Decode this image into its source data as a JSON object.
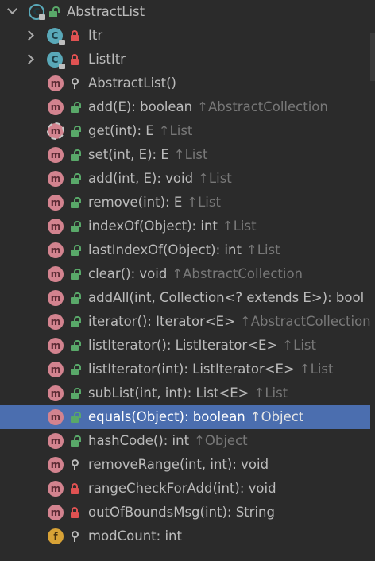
{
  "root": {
    "label": "AbstractList",
    "kind_letter": "C",
    "visibility": "public"
  },
  "inner_classes": [
    {
      "label": "Itr",
      "kind_letter": "C",
      "visibility": "private"
    },
    {
      "label": "ListItr",
      "kind_letter": "C",
      "visibility": "private"
    }
  ],
  "members": [
    {
      "kind": "method",
      "letter": "m",
      "visibility": "protected",
      "label": "AbstractList()",
      "inherited_from": ""
    },
    {
      "kind": "method",
      "letter": "m",
      "visibility": "public",
      "label": "add(E): boolean",
      "inherited_from": "AbstractCollection"
    },
    {
      "kind": "method",
      "letter": "m",
      "visibility": "public",
      "label": "get(int): E",
      "inherited_from": "List",
      "abstract": true
    },
    {
      "kind": "method",
      "letter": "m",
      "visibility": "public",
      "label": "set(int, E): E",
      "inherited_from": "List"
    },
    {
      "kind": "method",
      "letter": "m",
      "visibility": "public",
      "label": "add(int, E): void",
      "inherited_from": "List"
    },
    {
      "kind": "method",
      "letter": "m",
      "visibility": "public",
      "label": "remove(int): E",
      "inherited_from": "List"
    },
    {
      "kind": "method",
      "letter": "m",
      "visibility": "public",
      "label": "indexOf(Object): int",
      "inherited_from": "List"
    },
    {
      "kind": "method",
      "letter": "m",
      "visibility": "public",
      "label": "lastIndexOf(Object): int",
      "inherited_from": "List"
    },
    {
      "kind": "method",
      "letter": "m",
      "visibility": "public",
      "label": "clear(): void",
      "inherited_from": "AbstractCollection"
    },
    {
      "kind": "method",
      "letter": "m",
      "visibility": "public",
      "label": "addAll(int, Collection<? extends E>): bool",
      "inherited_from": ""
    },
    {
      "kind": "method",
      "letter": "m",
      "visibility": "public",
      "label": "iterator(): Iterator<E>",
      "inherited_from": "AbstractCollection"
    },
    {
      "kind": "method",
      "letter": "m",
      "visibility": "public",
      "label": "listIterator(): ListIterator<E>",
      "inherited_from": "List"
    },
    {
      "kind": "method",
      "letter": "m",
      "visibility": "public",
      "label": "listIterator(int): ListIterator<E>",
      "inherited_from": "List"
    },
    {
      "kind": "method",
      "letter": "m",
      "visibility": "public",
      "label": "subList(int, int): List<E>",
      "inherited_from": "List"
    },
    {
      "kind": "method",
      "letter": "m",
      "visibility": "public",
      "label": "equals(Object): boolean",
      "inherited_from": "Object",
      "selected": true
    },
    {
      "kind": "method",
      "letter": "m",
      "visibility": "public",
      "label": "hashCode(): int",
      "inherited_from": "Object"
    },
    {
      "kind": "method",
      "letter": "m",
      "visibility": "protected",
      "label": "removeRange(int, int): void",
      "inherited_from": ""
    },
    {
      "kind": "method",
      "letter": "m",
      "visibility": "private",
      "label": "rangeCheckForAdd(int): void",
      "inherited_from": ""
    },
    {
      "kind": "method",
      "letter": "m",
      "visibility": "private",
      "label": "outOfBoundsMsg(int): String",
      "inherited_from": ""
    },
    {
      "kind": "field",
      "letter": "f",
      "visibility": "protected",
      "label": "modCount: int",
      "inherited_from": ""
    }
  ],
  "colors": {
    "background": "#2b2b2b",
    "selection": "#4b6eaf",
    "method_icon": "#d3838f",
    "class_icon": "#59a8b8",
    "field_icon": "#d8a236",
    "public": "#59a869",
    "private": "#e05252"
  }
}
